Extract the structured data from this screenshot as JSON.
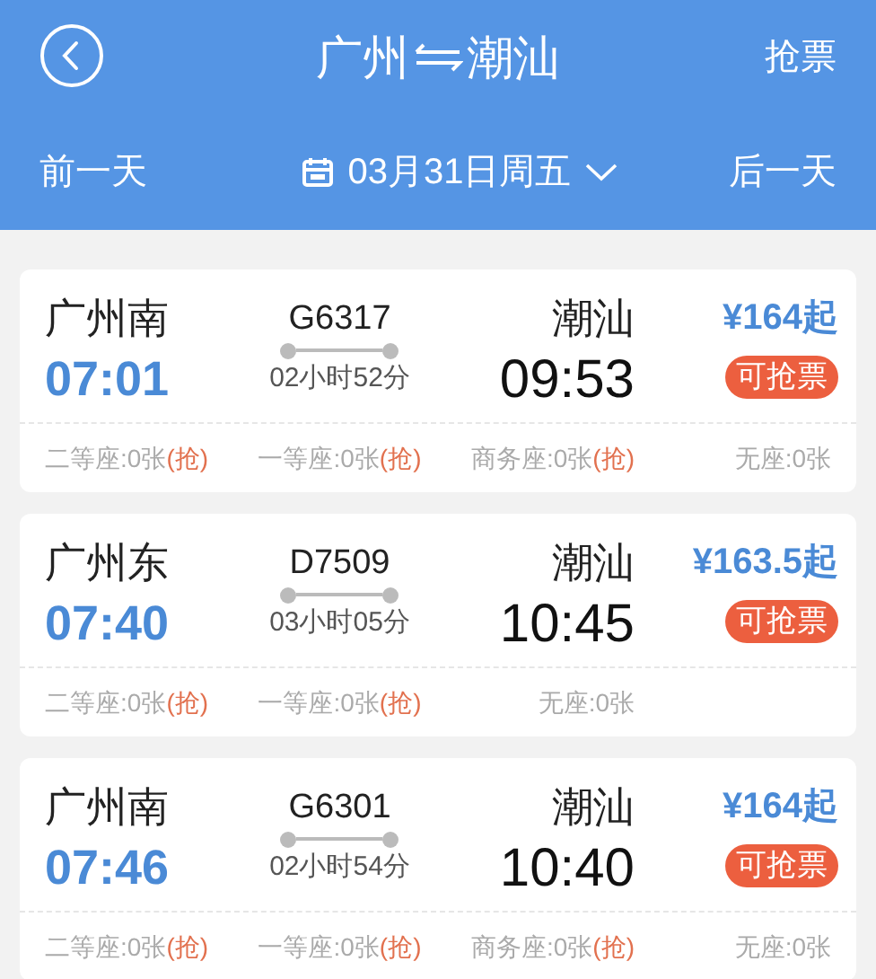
{
  "header": {
    "from": "广州",
    "to": "潮汕",
    "action": "抢票"
  },
  "date_bar": {
    "prev": "前一天",
    "date": "03月31日周五",
    "next": "后一天"
  },
  "trains": [
    {
      "depart_station": "广州南",
      "depart_time": "07:01",
      "code": "G6317",
      "duration": "02小时52分",
      "arrive_station": "潮汕",
      "arrive_time": "09:53",
      "price": "¥164起",
      "badge": "可抢票",
      "seats": [
        {
          "text": "二等座:0张",
          "grab": "(抢)"
        },
        {
          "text": "一等座:0张",
          "grab": "(抢)"
        },
        {
          "text": "商务座:0张",
          "grab": "(抢)"
        },
        {
          "text": "无座:0张"
        }
      ]
    },
    {
      "depart_station": "广州东",
      "depart_time": "07:40",
      "code": "D7509",
      "duration": "03小时05分",
      "arrive_station": "潮汕",
      "arrive_time": "10:45",
      "price": "¥163.5起",
      "badge": "可抢票",
      "seats": [
        {
          "text": "二等座:0张",
          "grab": "(抢)"
        },
        {
          "text": "一等座:0张",
          "grab": "(抢)"
        },
        {
          "text": "无座:0张"
        }
      ]
    },
    {
      "depart_station": "广州南",
      "depart_time": "07:46",
      "code": "G6301",
      "duration": "02小时54分",
      "arrive_station": "潮汕",
      "arrive_time": "10:40",
      "price": "¥164起",
      "badge": "可抢票",
      "seats": [
        {
          "text": "二等座:0张",
          "grab": "(抢)"
        },
        {
          "text": "一等座:0张",
          "grab": "(抢)"
        },
        {
          "text": "商务座:0张",
          "grab": "(抢)"
        },
        {
          "text": "无座:0张"
        }
      ]
    }
  ]
}
